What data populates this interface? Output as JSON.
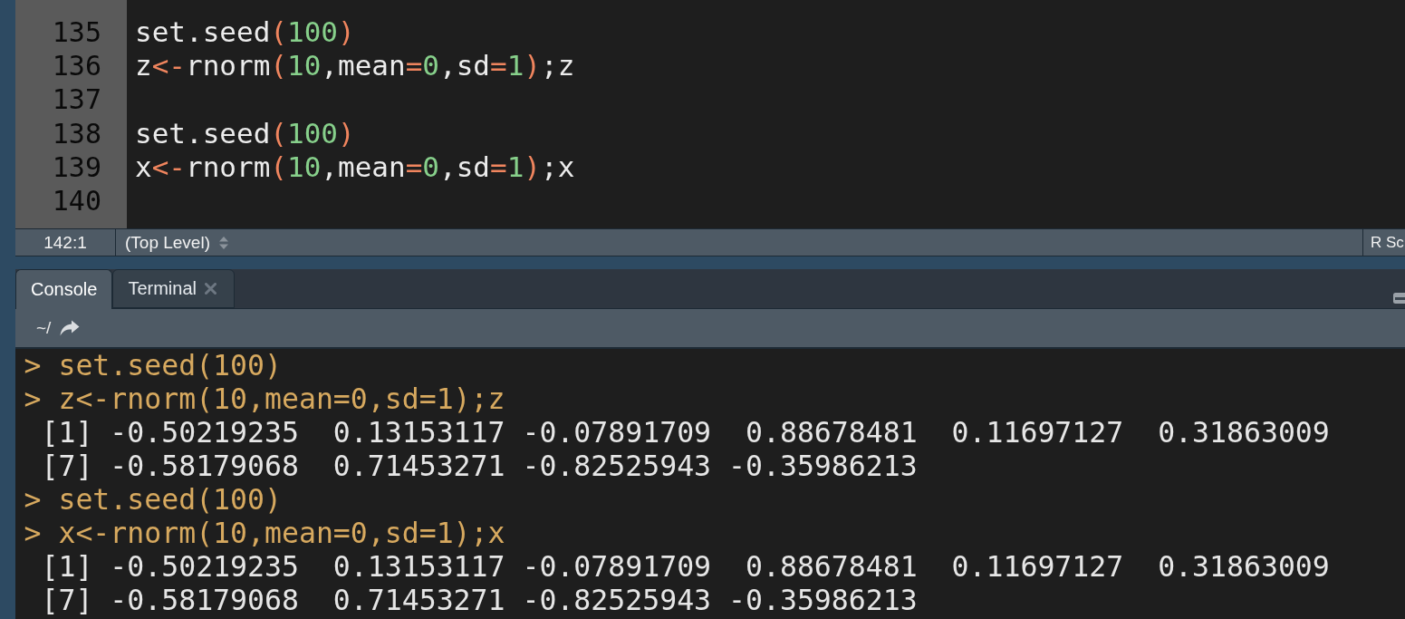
{
  "editor": {
    "lines": [
      {
        "number": "135",
        "code": [
          {
            "kind": "plain",
            "text": "set.seed"
          },
          {
            "kind": "symbol",
            "text": "("
          },
          {
            "kind": "number",
            "text": "100"
          },
          {
            "kind": "symbol",
            "text": ")"
          }
        ]
      },
      {
        "number": "136",
        "code": [
          {
            "kind": "plain",
            "text": "z"
          },
          {
            "kind": "symbol",
            "text": "<-"
          },
          {
            "kind": "plain",
            "text": "rnorm"
          },
          {
            "kind": "symbol",
            "text": "("
          },
          {
            "kind": "number",
            "text": "10"
          },
          {
            "kind": "plain",
            "text": ",mean"
          },
          {
            "kind": "symbol",
            "text": "="
          },
          {
            "kind": "number",
            "text": "0"
          },
          {
            "kind": "plain",
            "text": ",sd"
          },
          {
            "kind": "symbol",
            "text": "="
          },
          {
            "kind": "number",
            "text": "1"
          },
          {
            "kind": "symbol",
            "text": ")"
          },
          {
            "kind": "plain",
            "text": ";z"
          }
        ]
      },
      {
        "number": "137"
      },
      {
        "number": "138",
        "code": [
          {
            "kind": "plain",
            "text": "set.seed"
          },
          {
            "kind": "symbol",
            "text": "("
          },
          {
            "kind": "number",
            "text": "100"
          },
          {
            "kind": "symbol",
            "text": ")"
          }
        ]
      },
      {
        "number": "139",
        "code": [
          {
            "kind": "plain",
            "text": "x"
          },
          {
            "kind": "symbol",
            "text": "<-"
          },
          {
            "kind": "plain",
            "text": "rnorm"
          },
          {
            "kind": "symbol",
            "text": "("
          },
          {
            "kind": "number",
            "text": "10"
          },
          {
            "kind": "plain",
            "text": ",mean"
          },
          {
            "kind": "symbol",
            "text": "="
          },
          {
            "kind": "number",
            "text": "0"
          },
          {
            "kind": "plain",
            "text": ",sd"
          },
          {
            "kind": "symbol",
            "text": "="
          },
          {
            "kind": "number",
            "text": "1"
          },
          {
            "kind": "symbol",
            "text": ")"
          },
          {
            "kind": "plain",
            "text": ";x"
          }
        ]
      },
      {
        "number": "140"
      }
    ]
  },
  "status_bar": {
    "position": "142:1",
    "scope": "(Top Level)",
    "file_type": "R Sc"
  },
  "console_pane": {
    "tabs": [
      {
        "label": "Console",
        "selected": true,
        "closable": false
      },
      {
        "label": "Terminal",
        "selected": false,
        "closable": true
      }
    ],
    "path": "~/",
    "lines": [
      {
        "kind": "input",
        "text": "> set.seed(100)"
      },
      {
        "kind": "input",
        "text": "> z<-rnorm(10,mean=0,sd=1);z"
      },
      {
        "kind": "output",
        "text": "[1] -0.50219235  0.13153117 -0.07891709  0.88678481  0.11697127  0.31863009"
      },
      {
        "kind": "output",
        "text": "[7] -0.58179068  0.71453271 -0.82525943 -0.35986213"
      },
      {
        "kind": "input",
        "text": "> set.seed(100)"
      },
      {
        "kind": "input",
        "text": "> x<-rnorm(10,mean=0,sd=1);x"
      },
      {
        "kind": "output",
        "text": "[1] -0.50219235  0.13153117 -0.07891709  0.88678481  0.11697127  0.31863009"
      },
      {
        "kind": "output",
        "text": "[7] -0.58179068  0.71453271 -0.82525943 -0.35986213"
      }
    ]
  }
}
